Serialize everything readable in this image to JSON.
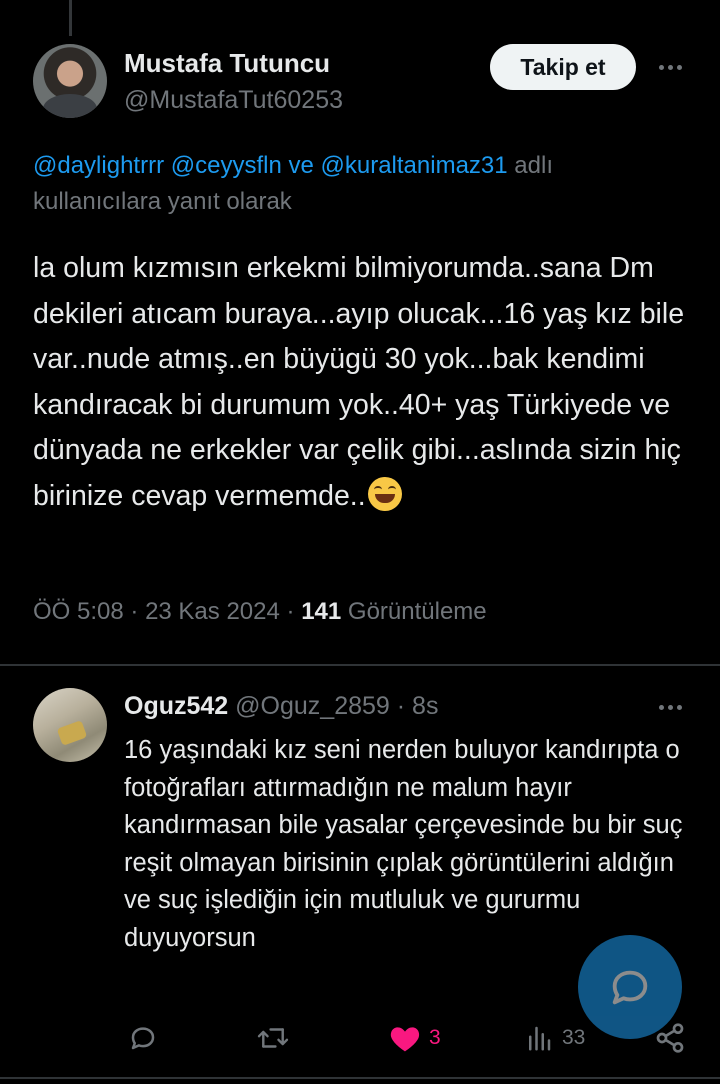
{
  "tweet": {
    "author_name": "Mustafa Tutuncu",
    "author_handle": "@MustafaTut60253",
    "follow_label": "Takip et",
    "reply_to": {
      "mentions": [
        "@daylightrrr",
        "@ceyysfln",
        "@kuraltanimaz31"
      ],
      "connector": "ve",
      "suffix": "adlı kullanıcılara yanıt olarak"
    },
    "text": "la olum kızmısın erkekmi bilmiyorumda..sana Dm dekileri atıcam buraya...ayıp olucak...16 yaş kız bile var..nude atmış..en büyügü 30 yok...bak kendimi kandıracak bi durumum yok..40+ yaş Türkiyede ve dünyada ne erkekler var çelik gibi...aslında sizin hiç birinize cevap vermemde..",
    "emoji": "grinning-squinting-face",
    "time": "ÖÖ 5:08",
    "date": "23 Kas 2024",
    "separator": "·",
    "views_count": "141",
    "views_label": "Görüntüleme"
  },
  "reply": {
    "author_name": "Oguz542",
    "author_handle": "@Oguz_2859",
    "separator": "·",
    "time_ago": "8s",
    "text": "16 yaşındaki kız seni nerden buluyor kandırıpta o fotoğrafları attırmadığın ne malum hayır kandırmasan bile yasalar çerçevesinde bu bir suç reşit olmayan birisinin çıplak görüntülerini aldığın ve suç işlediğin için mutluluk ve gururmu duyuyorsun",
    "actions": {
      "replies": "",
      "retweets": "",
      "likes": "3",
      "views": "33"
    }
  },
  "colors": {
    "background": "#000000",
    "text": "#e7e9ea",
    "muted": "#71767b",
    "accent": "#1d9bf0",
    "like": "#f91880"
  },
  "icons": {
    "more": "more-horizontal-icon",
    "reply": "reply-icon",
    "retweet": "retweet-icon",
    "like": "heart-filled-icon",
    "views": "analytics-icon",
    "share": "share-icon",
    "compose": "compose-reply-icon"
  }
}
